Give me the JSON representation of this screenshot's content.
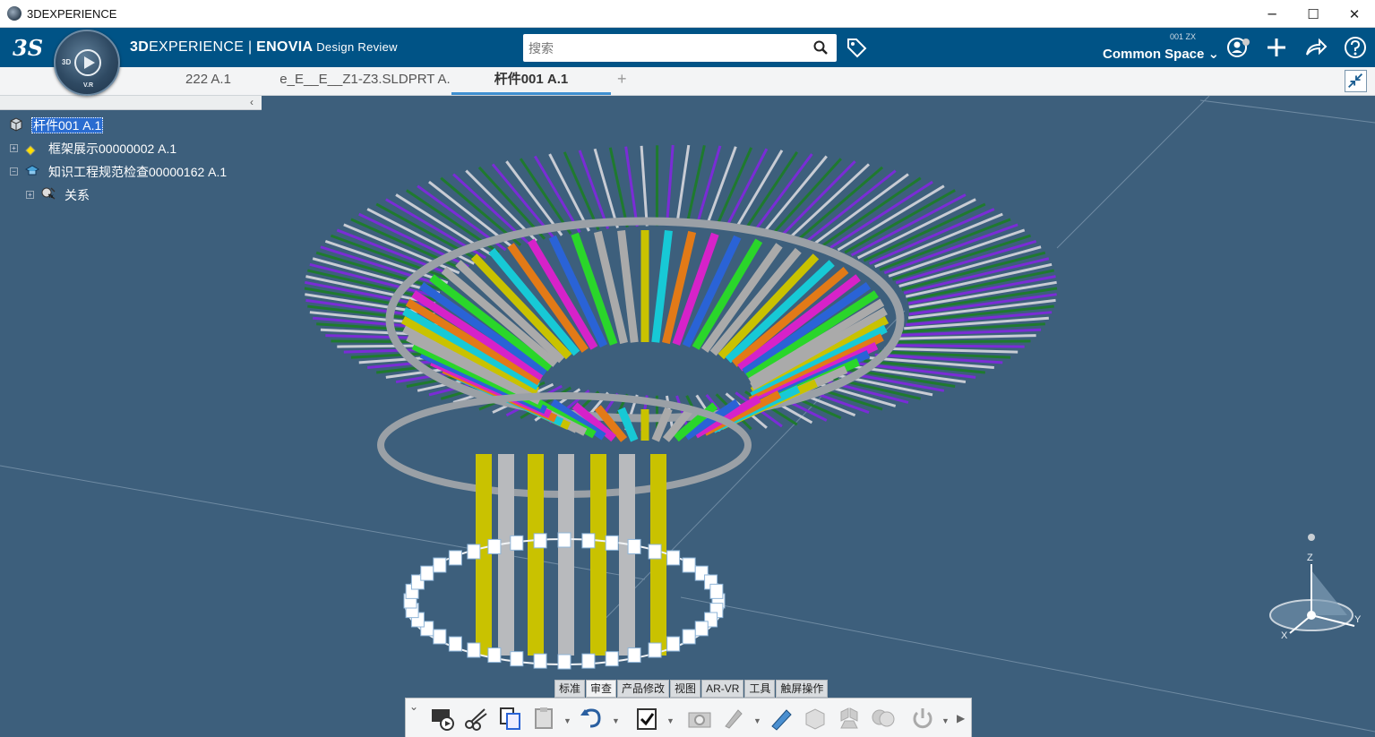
{
  "window": {
    "title": "3DEXPERIENCE",
    "minimize": "─",
    "maximize": "☐",
    "close": "✕"
  },
  "header": {
    "logo": "3S",
    "compass_top": "3D",
    "compass_bottom": "V.R",
    "brand_prefix": "3D",
    "brand_experience": "EXPERIENCE",
    "brand_sep": " | ",
    "brand_app": "ENOVIA",
    "brand_sub": " Design Review",
    "search_placeholder": "搜索",
    "space_small": "001 ZX",
    "space_name": "Common Space",
    "space_caret": "⌄"
  },
  "tabs": [
    {
      "label": "222 A.1"
    },
    {
      "label": "e_E__E__Z1-Z3.SLDPRT A."
    },
    {
      "label": "杆件001 A.1"
    }
  ],
  "tab_add": "+",
  "tree_collapse": "‹",
  "tree": [
    {
      "label": "杆件001 A.1"
    },
    {
      "label": "框架展示00000002 A.1"
    },
    {
      "label": "知识工程规范检查00000162 A.1"
    },
    {
      "label": "关系"
    }
  ],
  "compass_axes": {
    "z": "Z",
    "x": "X",
    "y": "Y"
  },
  "command_tabs": [
    "标准",
    "审查",
    "产品修改",
    "视图",
    "AR-VR",
    "工具",
    "触屏操作"
  ],
  "active_command_tab": "审查",
  "actionbar_expand": "⌄",
  "colors": {
    "header": "#005386",
    "viewport": "#3d5f7c",
    "purple": "#7a2cd6",
    "green": "#1f7a2e",
    "yellow": "#c9c200",
    "cyan": "#17c9d6",
    "orange": "#e27a17",
    "magenta": "#d622c9",
    "blue": "#2a63d6"
  }
}
